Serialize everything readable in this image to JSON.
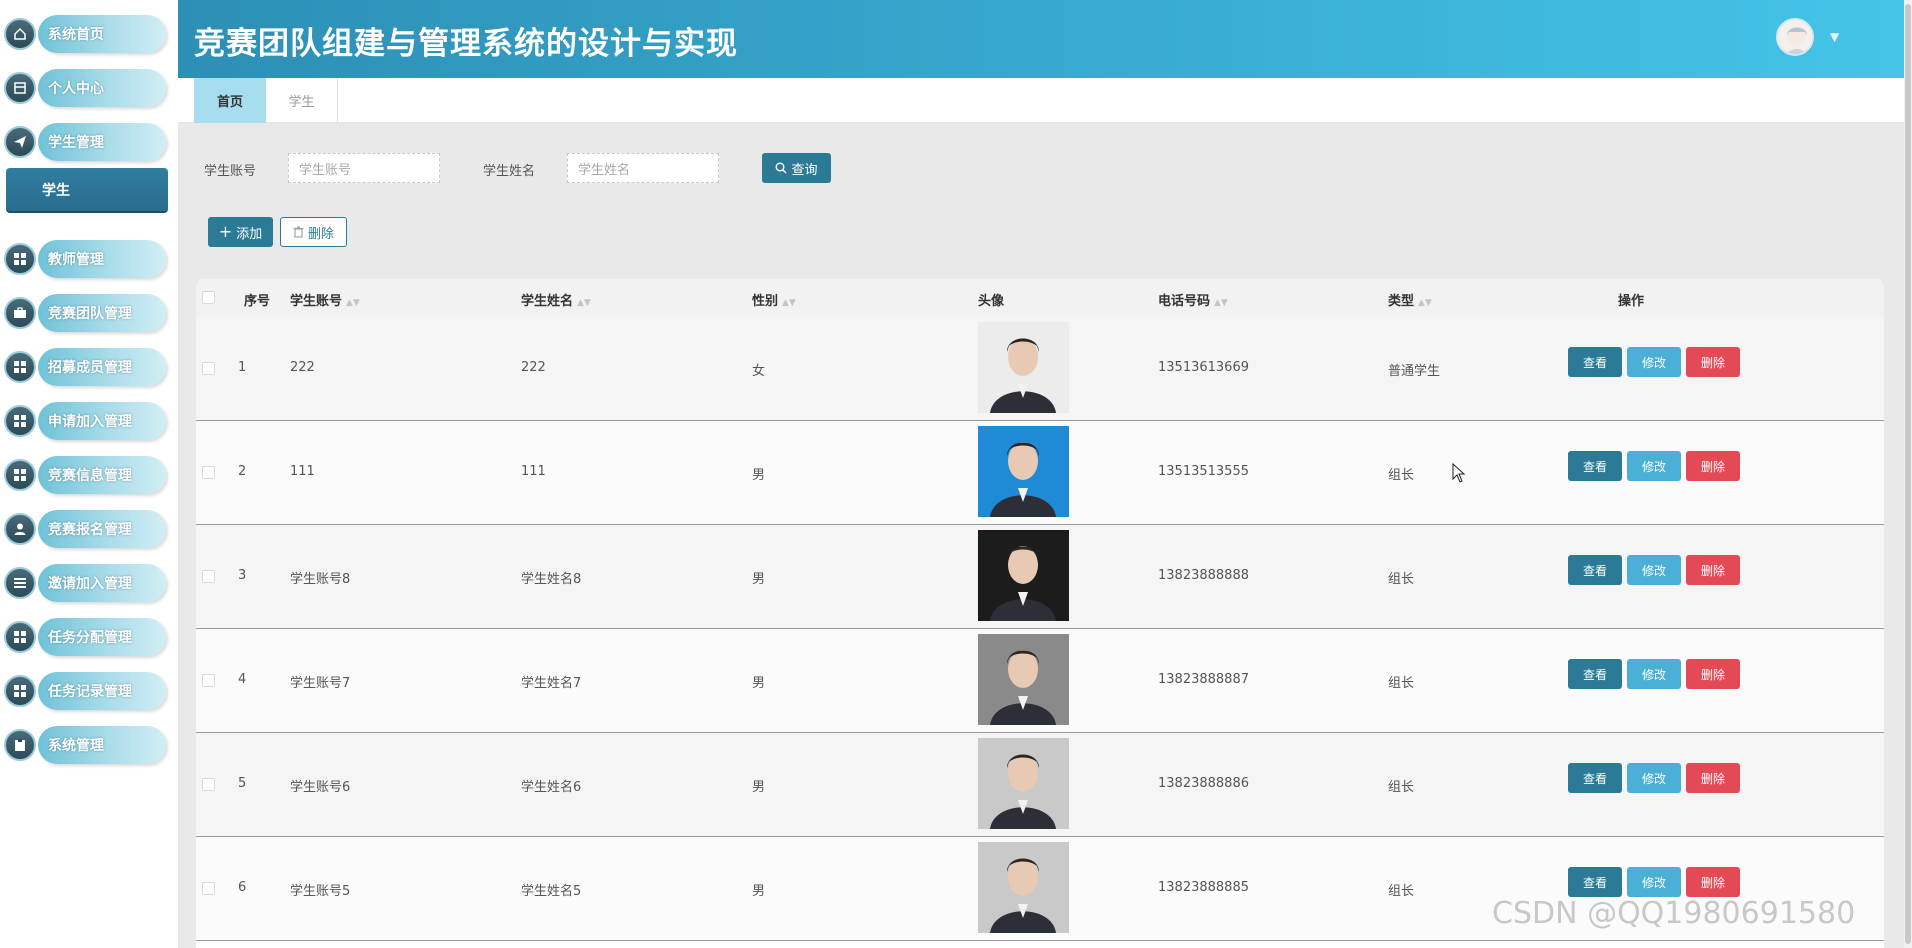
{
  "app": {
    "title": "竞赛团队组建与管理系统的设计与实现"
  },
  "sidebar": {
    "items": [
      {
        "label": "系统首页",
        "icon": "home-icon"
      },
      {
        "label": "个人中心",
        "icon": "profile-icon"
      },
      {
        "label": "学生管理",
        "icon": "send-icon"
      },
      {
        "label": "教师管理",
        "icon": "grid-icon"
      },
      {
        "label": "竞赛团队管理",
        "icon": "briefcase-icon"
      },
      {
        "label": "招募成员管理",
        "icon": "grid-icon"
      },
      {
        "label": "申请加入管理",
        "icon": "grid-icon"
      },
      {
        "label": "竞赛信息管理",
        "icon": "grid-icon"
      },
      {
        "label": "竞赛报名管理",
        "icon": "user-icon"
      },
      {
        "label": "邀请加入管理",
        "icon": "list-icon"
      },
      {
        "label": "任务分配管理",
        "icon": "grid-icon"
      },
      {
        "label": "任务记录管理",
        "icon": "grid-icon"
      },
      {
        "label": "系统管理",
        "icon": "clipboard-icon"
      }
    ],
    "submenu": {
      "label": "学生"
    }
  },
  "tabs": [
    {
      "label": "首页"
    },
    {
      "label": "学生"
    }
  ],
  "search": {
    "account_label": "学生账号",
    "account_placeholder": "学生账号",
    "name_label": "学生姓名",
    "name_placeholder": "学生姓名",
    "query_label": "查询"
  },
  "toolbar": {
    "add_label": "添加",
    "delete_label": "删除"
  },
  "table": {
    "headers": [
      "序号",
      "学生账号",
      "学生姓名",
      "性别",
      "头像",
      "电话号码",
      "类型",
      "操作"
    ],
    "actions": {
      "view": "查看",
      "edit": "修改",
      "delete": "删除"
    },
    "rows": [
      {
        "index": "1",
        "account": "222",
        "name": "222",
        "gender": "女",
        "phone": "13513613669",
        "type": "普通学生",
        "photo_bg": "#ececec"
      },
      {
        "index": "2",
        "account": "111",
        "name": "111",
        "gender": "男",
        "phone": "13513513555",
        "type": "组长",
        "photo_bg": "#1f8ad6"
      },
      {
        "index": "3",
        "account": "学生账号8",
        "name": "学生姓名8",
        "gender": "男",
        "phone": "13823888888",
        "type": "组长",
        "photo_bg": "#1c1c1c"
      },
      {
        "index": "4",
        "account": "学生账号7",
        "name": "学生姓名7",
        "gender": "男",
        "phone": "13823888887",
        "type": "组长",
        "photo_bg": "#8a8a8a"
      },
      {
        "index": "5",
        "account": "学生账号6",
        "name": "学生姓名6",
        "gender": "男",
        "phone": "13823888886",
        "type": "组长",
        "photo_bg": "#c9c9c9"
      },
      {
        "index": "6",
        "account": "学生账号5",
        "name": "学生姓名5",
        "gender": "男",
        "phone": "13823888885",
        "type": "组长",
        "photo_bg": "#c9c9c9"
      }
    ]
  },
  "watermark": "CSDN @QQ1980691580",
  "colors": {
    "header": "#39aed3",
    "primary": "#2b7a96",
    "edit": "#4bb0d8",
    "danger": "#e44a55"
  }
}
